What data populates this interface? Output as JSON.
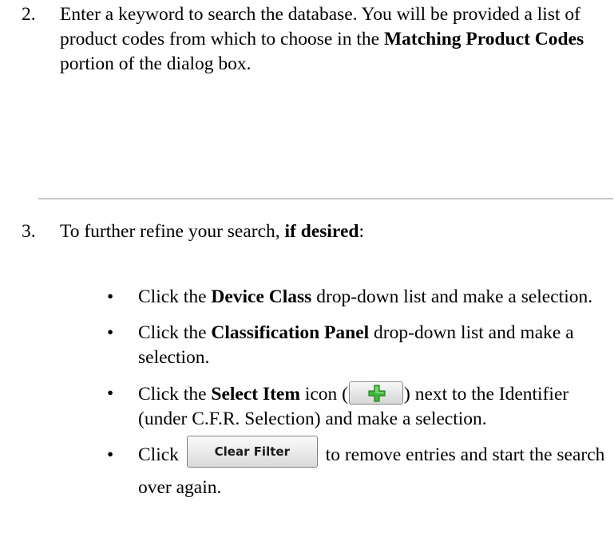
{
  "step2": {
    "number": "2.",
    "text_1": "Enter a keyword to search the database.  You will be provided a list of product codes from which to choose in the ",
    "bold_1": "Matching Product Codes",
    "text_2": " portion of the dialog box."
  },
  "step3": {
    "number": "3.",
    "text_1": "To further refine your search, ",
    "bold_1": "if desired",
    "text_2": ":"
  },
  "bullets": [
    {
      "text_1": "Click the ",
      "bold_1": "Device Class",
      "text_2": " drop-down list and make a selection."
    },
    {
      "text_1": "Click the ",
      "bold_1": "Classification Panel",
      "text_2": " drop-down list and make a selection."
    },
    {
      "text_1": "Click the ",
      "bold_1": "Select Item",
      "text_2": " icon (",
      "icon": "green-plus-icon",
      "text_3": ") next to the Identifier (under C.F.R. Selection) and make a selection."
    },
    {
      "text_1": "Click ",
      "button_label": "Clear Filter",
      "text_2": " to remove entries and start the search over again."
    }
  ],
  "bullet_char": "•",
  "colors": {
    "plus_fill": "#3cb83a",
    "plus_outline": "#2a7d28",
    "divider": "#c8c8c8"
  }
}
